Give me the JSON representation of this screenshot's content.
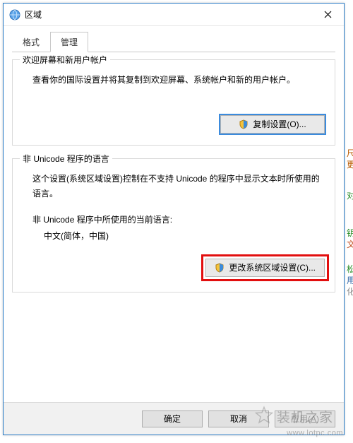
{
  "window": {
    "title": "区域"
  },
  "tabs": {
    "items": [
      {
        "label": "格式"
      },
      {
        "label": "管理"
      }
    ],
    "active_index": 1
  },
  "group_welcome": {
    "title": "欢迎屏幕和新用户帐户",
    "text": "查看你的国际设置并将其复制到欢迎屏幕、系统帐户和新的用户帐户。",
    "button": "复制设置(O)..."
  },
  "group_nonunicode": {
    "title": "非 Unicode 程序的语言",
    "text": "这个设置(系统区域设置)控制在不支持 Unicode 的程序中显示文本时所使用的语言。",
    "current_label": "非 Unicode 程序中所使用的当前语言:",
    "current_value": "中文(简体，中国)",
    "button": "更改系统区域设置(C)..."
  },
  "footer": {
    "ok": "确定",
    "cancel": "取消",
    "apply": "应用(A)"
  },
  "edge": {
    "c1": "尺",
    "c2": "更",
    "c3": "对",
    "c4": "钥",
    "c5": "文",
    "c6": "松",
    "c7": "用",
    "c8": "化"
  },
  "watermark": {
    "text": "装机之家",
    "url": "www.lotpc.com"
  }
}
